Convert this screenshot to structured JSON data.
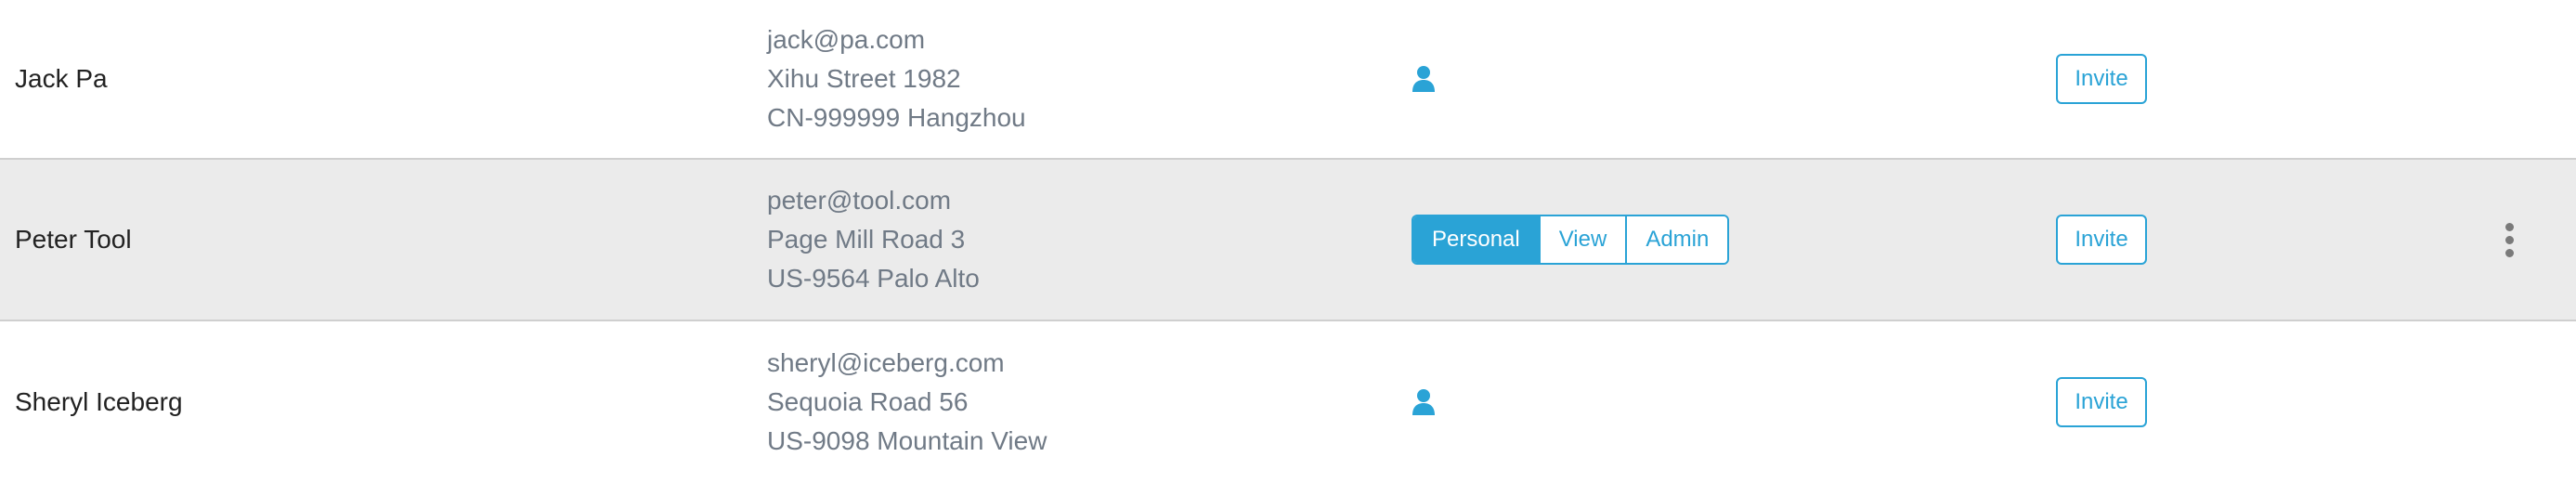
{
  "users": [
    {
      "name": "Jack Pa",
      "email": "jack@pa.com",
      "street": "Xihu Street 1982",
      "city": "CN-999999 Hangzhou",
      "role_icon": "person-icon",
      "invite_label": "Invite"
    },
    {
      "name": "Peter Tool",
      "email": "peter@tool.com",
      "street": "Page Mill Road 3",
      "city": "US-9564 Palo Alto",
      "roles": [
        "Personal",
        "View",
        "Admin"
      ],
      "selected_role": "Personal",
      "invite_label": "Invite",
      "menu_icon": "kebab-menu-icon"
    },
    {
      "name": "Sheryl Iceberg",
      "email": "sheryl@iceberg.com",
      "street": "Sequoia Road 56",
      "city": "US-9098 Mountain View",
      "role_icon": "person-icon",
      "invite_label": "Invite"
    }
  ],
  "colors": {
    "accent": "#2aa3d6",
    "selected_row": "#ebebeb",
    "secondary_text": "#707a86",
    "divider": "#cfcfcf"
  }
}
